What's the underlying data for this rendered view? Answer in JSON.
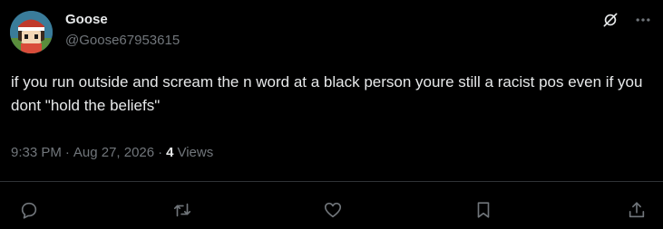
{
  "author": {
    "display_name": "Goose",
    "handle": "@Goose67953615"
  },
  "post": {
    "text": "if you run outside and scream the n word at a black person youre still a racist pos even if you dont \"hold the beliefs\"",
    "time": "9:33 PM",
    "date": "Aug 27, 2026",
    "separator": "·",
    "views_count": "4",
    "views_label": "Views"
  },
  "icons": {
    "grok": "grok-icon",
    "more": "more-icon",
    "reply": "reply-icon",
    "repost": "repost-icon",
    "like": "heart-icon",
    "bookmark": "bookmark-icon",
    "share": "share-icon"
  },
  "colors": {
    "background": "#000000",
    "primary_text": "#e7e9ea",
    "secondary_text": "#71767b",
    "divider": "#2f3336"
  }
}
